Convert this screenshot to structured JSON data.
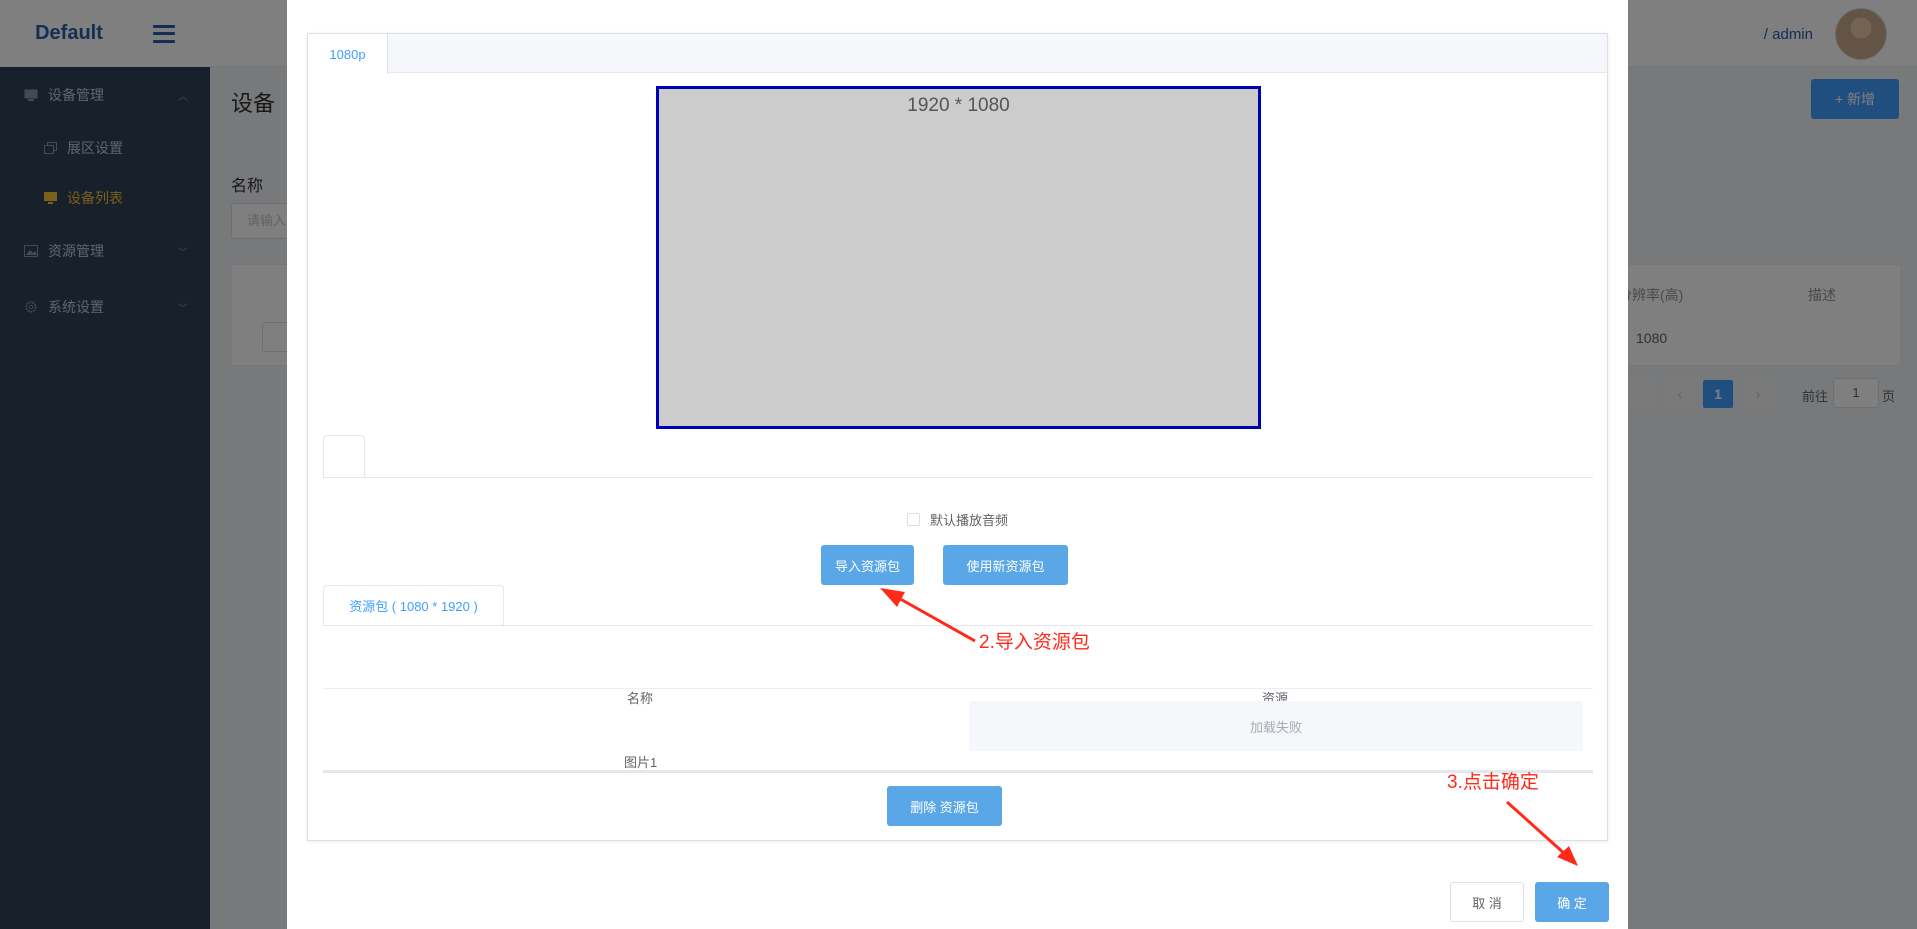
{
  "header": {
    "logo": "Default",
    "user": "/ admin"
  },
  "sidebar": {
    "groups": [
      {
        "label": "设备管理",
        "icon": "monitor-icon"
      },
      {
        "label": "资源管理",
        "icon": "image-icon"
      },
      {
        "label": "系统设置",
        "icon": "gear-icon"
      }
    ],
    "sub_items": [
      {
        "label": "展区设置",
        "icon": "copy-icon"
      },
      {
        "label": "设备列表",
        "icon": "monitor-icon"
      }
    ]
  },
  "page": {
    "title": "设备",
    "add_button": "+ 新增",
    "filter_label": "名称",
    "filter_placeholder": "请输入",
    "columns": [
      "分辨率(高)",
      "描述"
    ],
    "row_value": "1080",
    "pager": {
      "current": "1",
      "goto_label": "前往",
      "goto_value": "1",
      "page_suffix": "页"
    }
  },
  "dialog": {
    "resolution_tab": "1080p",
    "screen_label": "1920 * 1080",
    "audio_checkbox_label": "默认播放音频",
    "import_button": "导入资源包",
    "new_button": "使用新资源包",
    "package_tab": "资源包 ( 1080 * 1920 )",
    "table": {
      "headers": [
        "名称",
        "资源"
      ],
      "rows": [
        {
          "name": "图片1",
          "resource": "加载失败"
        }
      ]
    },
    "delete_button": "删除 资源包",
    "cancel_button": "取 消",
    "confirm_button": "确 定"
  },
  "annotations": {
    "step2": "2.导入资源包",
    "step3": "3.点击确定",
    "color": "#ff2a1a"
  },
  "colors": {
    "sidebar": "#304156",
    "primary": "#409eff",
    "screen_border": "#0000b3",
    "active_menu": "#f2c037"
  }
}
